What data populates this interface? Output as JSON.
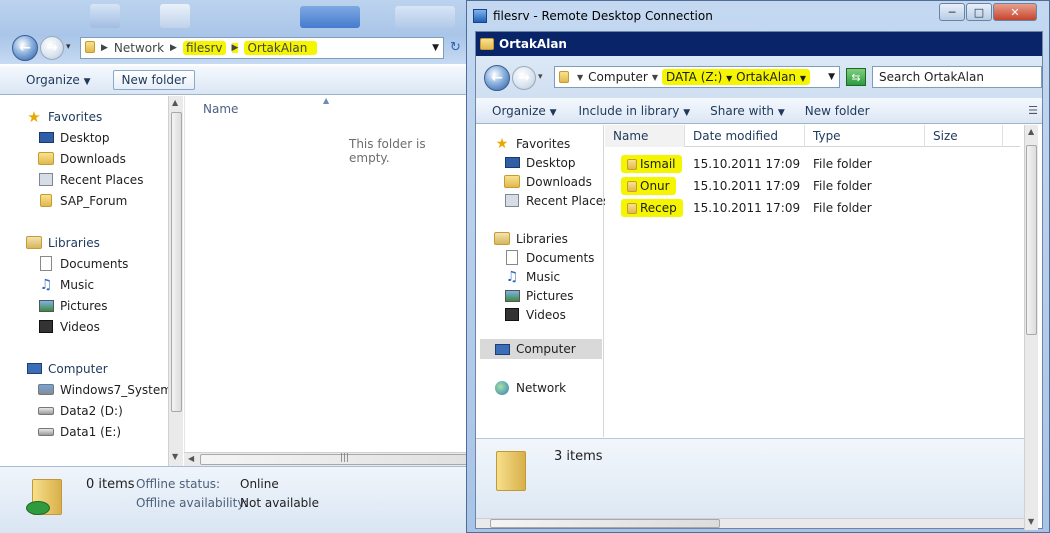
{
  "left_window": {
    "breadcrumb": {
      "network": "Network",
      "filesrv": "filesrv",
      "ortakalan": "OrtakAlan"
    },
    "toolbar": {
      "organize": "Organize",
      "new_folder": "New folder"
    },
    "nav": {
      "favorites": "Favorites",
      "desktop": "Desktop",
      "downloads": "Downloads",
      "recent_places": "Recent Places",
      "sap_forum": "SAP_Forum",
      "libraries": "Libraries",
      "documents": "Documents",
      "music": "Music",
      "pictures": "Pictures",
      "videos": "Videos",
      "computer": "Computer",
      "windows7_system": "Windows7_System (",
      "data2": "Data2 (D:)",
      "data1": "Data1 (E:)"
    },
    "content": {
      "col_name": "Name",
      "empty_text": "This folder is empty."
    },
    "status": {
      "items": "0 items",
      "offline_status_label": "Offline status:",
      "offline_status_value": "Online",
      "offline_avail_label": "Offline availability:",
      "offline_avail_value": "Not available"
    }
  },
  "rdp_window": {
    "title": "filesrv - Remote Desktop Connection",
    "inner_title": "OrtakAlan",
    "breadcrumb": {
      "computer": "Computer",
      "data": "DATA (Z:)",
      "ortakalan": "OrtakAlan"
    },
    "search_placeholder": "Search OrtakAlan",
    "toolbar": {
      "organize": "Organize",
      "include": "Include in library",
      "share": "Share with",
      "new_folder": "New folder"
    },
    "nav": {
      "favorites": "Favorites",
      "desktop": "Desktop",
      "downloads": "Downloads",
      "recent_places": "Recent Places",
      "libraries": "Libraries",
      "documents": "Documents",
      "music": "Music",
      "pictures": "Pictures",
      "videos": "Videos",
      "computer": "Computer",
      "network": "Network"
    },
    "columns": [
      "Name",
      "Date modified",
      "Type",
      "Size"
    ],
    "files": [
      {
        "name": "Ismail",
        "date": "15.10.2011 17:09",
        "type": "File folder"
      },
      {
        "name": "Onur",
        "date": "15.10.2011 17:09",
        "type": "File folder"
      },
      {
        "name": "Recep",
        "date": "15.10.2011 17:09",
        "type": "File folder"
      }
    ],
    "status_items": "3 items"
  }
}
